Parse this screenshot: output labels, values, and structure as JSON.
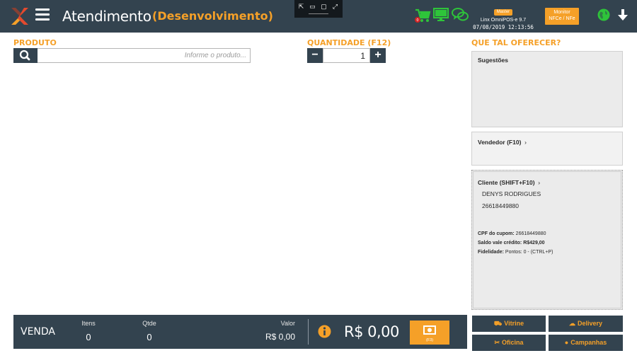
{
  "header": {
    "title": "Atendimento",
    "environment": "(Desenvolvimento)",
    "badge": "Master",
    "version": "Linx OmniPOS-e  9.7",
    "datetime": "07/08/2019 12:13:56",
    "monitor_line1": "Monitor",
    "monitor_line2": "NFCe / NFe",
    "icons": [
      "menu-icon",
      "cart-icon",
      "monitor-icon",
      "chat-icon",
      "globe-icon",
      "arrow-down-icon"
    ],
    "colors": {
      "bar": "#33434f",
      "accent": "#f5a028",
      "ok": "#2ec43a",
      "alert": "#d22222"
    }
  },
  "produto": {
    "label": "PRODUTO",
    "placeholder": "Informe o produto..."
  },
  "quantidade": {
    "label": "QUANTIDADE (F12)",
    "value": "1",
    "minus": "−",
    "plus": "+"
  },
  "sidebar": {
    "title": "QUE TAL OFERECER?",
    "sugestoes": "Sugestões",
    "vendedor": "Vendedor (F10)",
    "cliente": {
      "title": "Cliente (SHIFT+F10)",
      "name": "DENYS RODRIGUES",
      "code": "26618449880",
      "cpf_label": "CPF do cupom:",
      "cpf_value": "26618449880",
      "saldo_label": "Saldo vale crédito:",
      "saldo_value": "R$429,00",
      "fidelidade_label": "Fidelidade:",
      "fidelidade_value": "Pontos: 0 - (CTRL+P)"
    }
  },
  "footer": {
    "venda": "VENDA",
    "itens_label": "Itens",
    "itens_value": "0",
    "qtde_label": "Qtde",
    "qtde_value": "0",
    "valor_label": "Valor",
    "valor_value": "R$ 0,00",
    "total": "R$ 0,00",
    "pay_hint": "(F3)"
  },
  "actions": {
    "vitrine": "Vitrine",
    "delivery": "Delivery",
    "oficina": "Oficina",
    "campanhas": "Campanhas"
  }
}
